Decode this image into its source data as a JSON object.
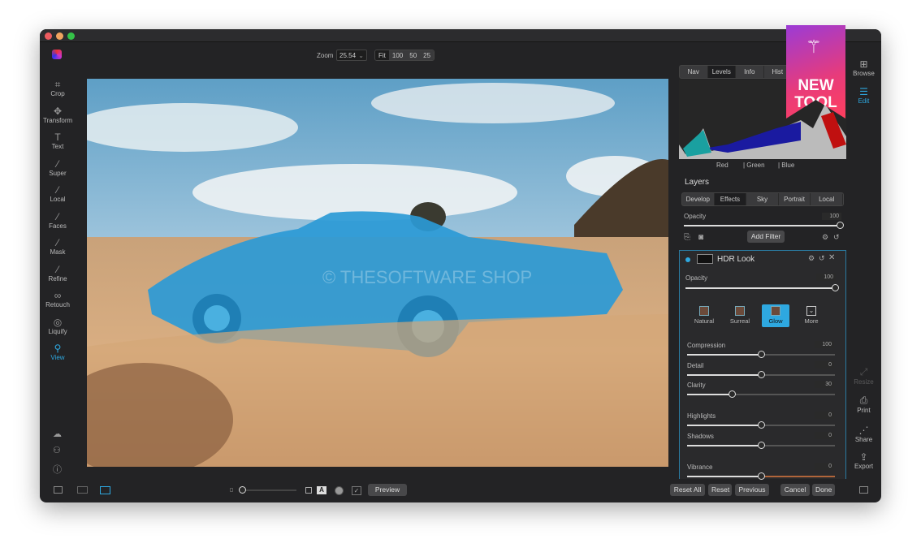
{
  "window": {
    "traffic": [
      "#ec5b5f",
      "#f0a35f",
      "#35c248"
    ]
  },
  "toolbar": {
    "zoom_label": "Zoom",
    "zoom_value": "25.54",
    "zoom_presets": [
      "Fit",
      "100",
      "50",
      "25"
    ]
  },
  "left_tools": [
    {
      "label": "Crop",
      "icon": "crop-icon",
      "glyph": "⌗"
    },
    {
      "label": "Transform",
      "icon": "move-icon",
      "glyph": "✥"
    },
    {
      "label": "Text",
      "icon": "text-icon",
      "glyph": "T"
    },
    {
      "label": "Super",
      "icon": "wand-icon",
      "glyph": "⁄"
    },
    {
      "label": "Local",
      "icon": "brush-icon",
      "glyph": "⁄"
    },
    {
      "label": "Faces",
      "icon": "faces-icon",
      "glyph": "⁄"
    },
    {
      "label": "Mask",
      "icon": "mask-icon",
      "glyph": "⁄"
    },
    {
      "label": "Refine",
      "icon": "refine-icon",
      "glyph": "⁄"
    },
    {
      "label": "Retouch",
      "icon": "retouch-icon",
      "glyph": "∞"
    },
    {
      "label": "Liquify",
      "icon": "liquify-icon",
      "glyph": "◎"
    },
    {
      "label": "View",
      "icon": "view-icon",
      "glyph": "⚲",
      "active": true
    }
  ],
  "canvas": {
    "watermark": "© THESOFTWARE SHOP"
  },
  "panel": {
    "top_tabs": [
      "Nav",
      "Levels",
      "Info",
      "Hist"
    ],
    "active_top_tab": "Levels",
    "histogram_channels": [
      "Red",
      "| Green",
      "| Blue"
    ],
    "layers_title": "Layers",
    "layer_tabs": [
      "Develop",
      "Effects",
      "Sky",
      "Portrait",
      "Local"
    ],
    "active_layer_tab": "Effects",
    "opacity_label": "Opacity",
    "opacity_value": "100",
    "opacity": 1.0,
    "add_filter": "Add Filter",
    "filter": {
      "title": "HDR Look",
      "opacity_label": "Opacity",
      "opacity_value": "100",
      "opacity": 1.0,
      "presets": [
        "Natural",
        "Surreal",
        "Glow",
        "More"
      ],
      "active_preset": "Glow",
      "sliders": [
        {
          "label": "Compression",
          "value": "100",
          "pos": 0.5
        },
        {
          "label": "Detail",
          "value": "0",
          "pos": 0.5
        },
        {
          "label": "Clarity",
          "value": "30",
          "pos": 0.3
        },
        {
          "label": "Highlights",
          "value": "0",
          "pos": 0.5
        },
        {
          "label": "Shadows",
          "value": "0",
          "pos": 0.5
        },
        {
          "label": "Vibrance",
          "value": "0",
          "pos": 0.5
        }
      ]
    }
  },
  "badge": {
    "line1": "NEW",
    "line2": "TOOL",
    "accent": "#e83b7a"
  },
  "right_sidebar": [
    {
      "label": "Browse",
      "icon": "browse-icon",
      "glyph": "⊞"
    },
    {
      "label": "Edit",
      "icon": "sliders-icon",
      "glyph": "☰",
      "active": true
    },
    {
      "label": "Resize",
      "icon": "resize-icon",
      "glyph": "⤢",
      "disabled": true
    },
    {
      "label": "Print",
      "icon": "print-icon",
      "glyph": "⎙"
    },
    {
      "label": "Share",
      "icon": "share-icon",
      "glyph": "⋰"
    },
    {
      "label": "Export",
      "icon": "export-icon",
      "glyph": "⇪"
    }
  ],
  "bottom": {
    "preview": "Preview",
    "reset_all": "Reset All",
    "reset": "Reset",
    "previous": "Previous",
    "cancel": "Cancel",
    "done": "Done",
    "a_label": "A"
  },
  "accent": "#2ea8e0"
}
